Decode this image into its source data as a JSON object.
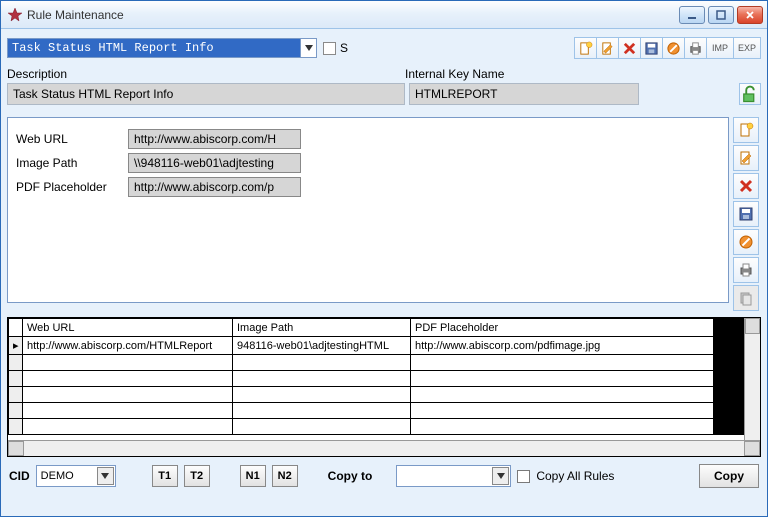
{
  "window": {
    "title": "Rule Maintenance"
  },
  "top": {
    "rule_name": "Task Status HTML Report Info",
    "s_label": "S",
    "imp": "IMP",
    "exp": "EXP"
  },
  "labels": {
    "description": "Description",
    "internal_key": "Internal Key Name"
  },
  "fields": {
    "description": "Task Status HTML Report Info",
    "internal_key": "HTMLREPORT"
  },
  "editor": {
    "rows": [
      {
        "label": "Web URL",
        "value": "http://www.abiscorp.com/H"
      },
      {
        "label": "Image Path",
        "value": "\\\\948116-web01\\adjtesting"
      },
      {
        "label": "PDF Placeholder",
        "value": "http://www.abiscorp.com/p"
      }
    ]
  },
  "grid": {
    "headers": [
      "Web URL",
      "Image Path",
      "PDF Placeholder"
    ],
    "rows": [
      [
        "http://www.abiscorp.com/HTMLReport",
        "948116-web01\\adjtestingHTML",
        "http://www.abiscorp.com/pdfimage.jpg"
      ]
    ]
  },
  "bottom": {
    "cid_label": "CID",
    "cid_value": "DEMO",
    "t1": "T1",
    "t2": "T2",
    "n1": "N1",
    "n2": "N2",
    "copyto_label": "Copy to",
    "copyall_label": "Copy All Rules",
    "copy_btn": "Copy"
  }
}
